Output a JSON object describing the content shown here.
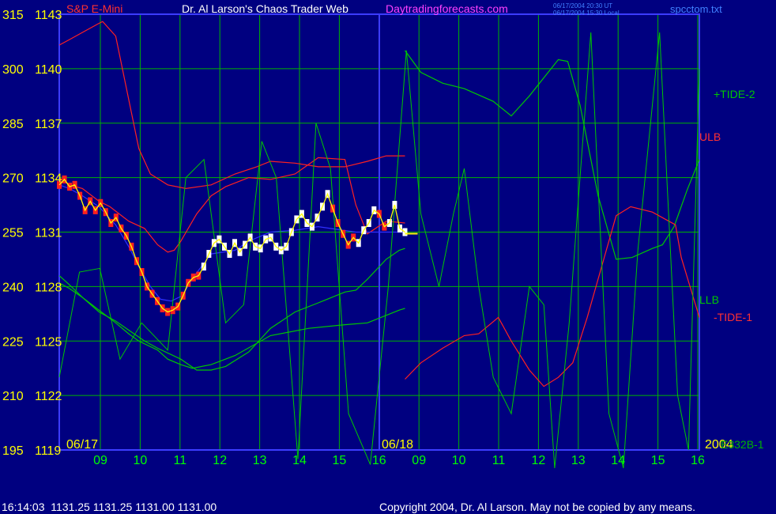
{
  "header": {
    "symbol": "S&P E-Mini",
    "title": "Dr. Al Larson's Chaos Trader Web",
    "site": "Daytradingforecasts.com",
    "time1": "06/17/2004 20:30 UT",
    "time2": "06/17/2004 15:30 Local",
    "file": "spcctom.txt"
  },
  "footer": {
    "quote": "16:14:03  1131.25 1131.25 1131.00 1131.00",
    "copyright": "Copyright 2004, Dr. Al Larson. May not be copied by any means."
  },
  "colors": {
    "background": "#000080",
    "grid": "#00B400",
    "frame": "#3C3CFF",
    "price_yellow": "#FFFF00",
    "tide_green": "#00C800",
    "tide_red": "#FF2020",
    "moving_avg": "#3030FF"
  },
  "chart_data": {
    "type": "line",
    "y_left_labels": [
      "315",
      "300",
      "285",
      "270",
      "255",
      "240",
      "225",
      "210",
      "195"
    ],
    "y_price_labels": [
      "1143",
      "1140",
      "1137",
      "1134",
      "1131",
      "1128",
      "1125",
      "1122",
      "1119"
    ],
    "ylim": [
      1119,
      1143
    ],
    "x_tick_labels": [
      "09",
      "10",
      "11",
      "12",
      "13",
      "14",
      "15",
      "16",
      "09",
      "10",
      "11",
      "12",
      "13",
      "14",
      "15",
      "16"
    ],
    "date_labels": [
      "06/17",
      "06/18",
      "2004"
    ],
    "series_labels": [
      "+TIDE-2",
      "ULB",
      "LLB",
      "-TIDE-1",
      "E332B-1"
    ],
    "price_bars": [
      1133.6,
      1133.9,
      1133.5,
      1133.6,
      1133.0,
      1132.2,
      1132.7,
      1132.2,
      1132.6,
      1132.1,
      1131.5,
      1131.8,
      1131.2,
      1130.8,
      1130.2,
      1129.4,
      1128.8,
      1128.0,
      1127.6,
      1127.2,
      1126.8,
      1126.6,
      1126.7,
      1126.9,
      1127.5,
      1128.2,
      1128.5,
      1128.6,
      1129.1,
      1129.8,
      1130.4,
      1130.6,
      1130.2,
      1129.8,
      1130.4,
      1129.9,
      1130.3,
      1130.7,
      1130.2,
      1130.1,
      1130.6,
      1130.7,
      1130.2,
      1130.0,
      1130.2,
      1131.0,
      1131.7,
      1132.0,
      1131.5,
      1131.3,
      1131.8,
      1132.4,
      1133.1,
      1132.3,
      1131.5,
      1130.9,
      1130.3,
      1130.7,
      1130.4,
      1131.1,
      1131.5,
      1132.2,
      1132.0,
      1131.3,
      1131.5,
      1132.5,
      1131.2,
      1131.0
    ],
    "series": [
      {
        "name": "+TIDE-2",
        "color": "#00C800",
        "points": [
          [
            0,
            1128.6
          ],
          [
            14,
            1128.1
          ],
          [
            32,
            1127.4
          ],
          [
            55,
            1126.7
          ],
          [
            78,
            1126.0
          ],
          [
            96,
            1125.4
          ],
          [
            110,
            1125.0
          ],
          [
            136,
            1124.5
          ],
          [
            150,
            1124.0
          ],
          [
            168,
            1123.7
          ],
          [
            184,
            1123.5
          ],
          [
            210,
            1123.7
          ],
          [
            243,
            1124.2
          ],
          [
            292,
            1125.3
          ],
          [
            345,
            1125.7
          ],
          [
            395,
            1125.9
          ],
          [
            426,
            1126.0
          ],
          [
            470,
            1126.7
          ],
          [
            478,
            1126.8
          ]
        ]
      },
      {
        "name": "ULB",
        "color": "#FF2020",
        "points": [
          [
            0,
            1141.3
          ],
          [
            14,
            1141.6
          ],
          [
            32,
            1142.0
          ],
          [
            55,
            1142.5
          ],
          [
            60,
            1142.6
          ],
          [
            78,
            1141.8
          ],
          [
            96,
            1138.3
          ],
          [
            110,
            1135.6
          ],
          [
            126,
            1134.2
          ],
          [
            150,
            1133.6
          ],
          [
            175,
            1133.4
          ],
          [
            210,
            1133.6
          ],
          [
            243,
            1134.2
          ],
          [
            273,
            1134.6
          ],
          [
            292,
            1134.9
          ],
          [
            326,
            1134.8
          ],
          [
            358,
            1134.6
          ],
          [
            395,
            1134.6
          ],
          [
            426,
            1134.9
          ],
          [
            452,
            1135.2
          ],
          [
            478,
            1135.2
          ]
        ]
      },
      {
        "name": "LLB",
        "color": "#00C800",
        "points": [
          [
            0,
            1128.2
          ],
          [
            14,
            1127.9
          ],
          [
            32,
            1127.4
          ],
          [
            55,
            1126.6
          ],
          [
            78,
            1126.1
          ],
          [
            96,
            1125.6
          ],
          [
            118,
            1125.0
          ],
          [
            136,
            1124.6
          ],
          [
            168,
            1124.0
          ],
          [
            190,
            1123.4
          ],
          [
            210,
            1123.4
          ],
          [
            230,
            1123.6
          ],
          [
            262,
            1124.4
          ],
          [
            292,
            1125.7
          ],
          [
            326,
            1126.6
          ],
          [
            358,
            1127.1
          ],
          [
            395,
            1127.7
          ],
          [
            410,
            1127.8
          ],
          [
            426,
            1128.4
          ],
          [
            452,
            1129.5
          ],
          [
            470,
            1130.0
          ],
          [
            478,
            1130.1
          ]
        ]
      },
      {
        "name": "-TIDE-1",
        "color": "#FF2020",
        "points": [
          [
            0,
            1134.0
          ],
          [
            14,
            1133.6
          ],
          [
            32,
            1133.4
          ],
          [
            55,
            1132.7
          ],
          [
            70,
            1132.4
          ],
          [
            96,
            1131.6
          ],
          [
            118,
            1131.2
          ],
          [
            136,
            1130.3
          ],
          [
            150,
            1129.9
          ],
          [
            159,
            1130.0
          ],
          [
            168,
            1130.5
          ],
          [
            190,
            1132.0
          ],
          [
            210,
            1133.0
          ],
          [
            230,
            1133.5
          ],
          [
            262,
            1134.0
          ],
          [
            292,
            1133.9
          ],
          [
            326,
            1134.2
          ],
          [
            358,
            1135.1
          ],
          [
            395,
            1135.0
          ],
          [
            410,
            1132.5
          ],
          [
            426,
            1130.9
          ],
          [
            452,
            1131.6
          ],
          [
            478,
            1131.5
          ]
        ]
      },
      {
        "name": "MA",
        "color": "#3030FF",
        "points": [
          [
            0,
            1133.6
          ],
          [
            14,
            1133.4
          ],
          [
            32,
            1133.0
          ],
          [
            55,
            1132.4
          ],
          [
            78,
            1131.4
          ],
          [
            96,
            1130.2
          ],
          [
            110,
            1129.1
          ],
          [
            126,
            1128.0
          ],
          [
            140,
            1127.3
          ],
          [
            155,
            1127.2
          ],
          [
            170,
            1127.5
          ],
          [
            185,
            1128.5
          ],
          [
            210,
            1129.8
          ],
          [
            243,
            1130.0
          ],
          [
            262,
            1130.5
          ],
          [
            292,
            1131.0
          ],
          [
            326,
            1131.1
          ],
          [
            358,
            1131.3
          ],
          [
            410,
            1131.0
          ],
          [
            478,
            1131.0
          ]
        ]
      },
      {
        "name": "+TIDE-2 forecast",
        "color": "#00C800",
        "points": [
          [
            478,
            1141.0
          ],
          [
            500,
            1139.8
          ],
          [
            530,
            1139.2
          ],
          [
            560,
            1138.9
          ],
          [
            600,
            1138.2
          ],
          [
            625,
            1137.4
          ],
          [
            650,
            1138.5
          ],
          [
            690,
            1140.5
          ],
          [
            703,
            1140.4
          ],
          [
            720,
            1138.0
          ],
          [
            745,
            1133.0
          ],
          [
            770,
            1129.5
          ],
          [
            792,
            1129.6
          ],
          [
            820,
            1130.1
          ],
          [
            834,
            1130.3
          ],
          [
            850,
            1131.3
          ],
          [
            868,
            1133.3
          ],
          [
            885,
            1135.0
          ]
        ]
      },
      {
        "name": "-TIDE-1 forecast",
        "color": "#FF2020",
        "points": [
          [
            478,
            1122.9
          ],
          [
            500,
            1123.8
          ],
          [
            530,
            1124.6
          ],
          [
            560,
            1125.3
          ],
          [
            580,
            1125.4
          ],
          [
            607,
            1126.3
          ],
          [
            625,
            1125.0
          ],
          [
            650,
            1123.4
          ],
          [
            670,
            1122.5
          ],
          [
            690,
            1123.0
          ],
          [
            710,
            1123.8
          ],
          [
            730,
            1126.3
          ],
          [
            770,
            1131.9
          ],
          [
            790,
            1132.4
          ],
          [
            820,
            1132.1
          ],
          [
            852,
            1131.4
          ],
          [
            860,
            1129.6
          ],
          [
            885,
            1126.3
          ]
        ]
      },
      {
        "name": "E332B-1",
        "color": "#00C800",
        "points": [
          [
            0,
            1123.0
          ],
          [
            28,
            1128.8
          ],
          [
            56,
            1129.0
          ],
          [
            84,
            1124.0
          ],
          [
            114,
            1126.0
          ],
          [
            150,
            1124.5
          ],
          [
            175,
            1134.0
          ],
          [
            200,
            1135.0
          ],
          [
            230,
            1126.0
          ],
          [
            255,
            1127.0
          ],
          [
            280,
            1136.0
          ],
          [
            300,
            1134.0
          ],
          [
            330,
            1118.5
          ],
          [
            355,
            1137.0
          ],
          [
            375,
            1134.5
          ],
          [
            400,
            1121.0
          ],
          [
            430,
            1118.2
          ],
          [
            455,
            1128.0
          ],
          [
            480,
            1141.0
          ],
          [
            500,
            1132.0
          ],
          [
            525,
            1128.0
          ],
          [
            545,
            1132.0
          ],
          [
            560,
            1134.5
          ],
          [
            580,
            1128.0
          ],
          [
            600,
            1123.0
          ],
          [
            625,
            1121.0
          ],
          [
            650,
            1128.0
          ],
          [
            670,
            1127.0
          ],
          [
            685,
            1118.0
          ],
          [
            705,
            1126.0
          ],
          [
            735,
            1142.0
          ],
          [
            760,
            1121.0
          ],
          [
            780,
            1118.0
          ],
          [
            800,
            1130.0
          ],
          [
            830,
            1142.0
          ],
          [
            855,
            1122.0
          ],
          [
            870,
            1119.0
          ],
          [
            885,
            1140.0
          ]
        ]
      }
    ]
  }
}
